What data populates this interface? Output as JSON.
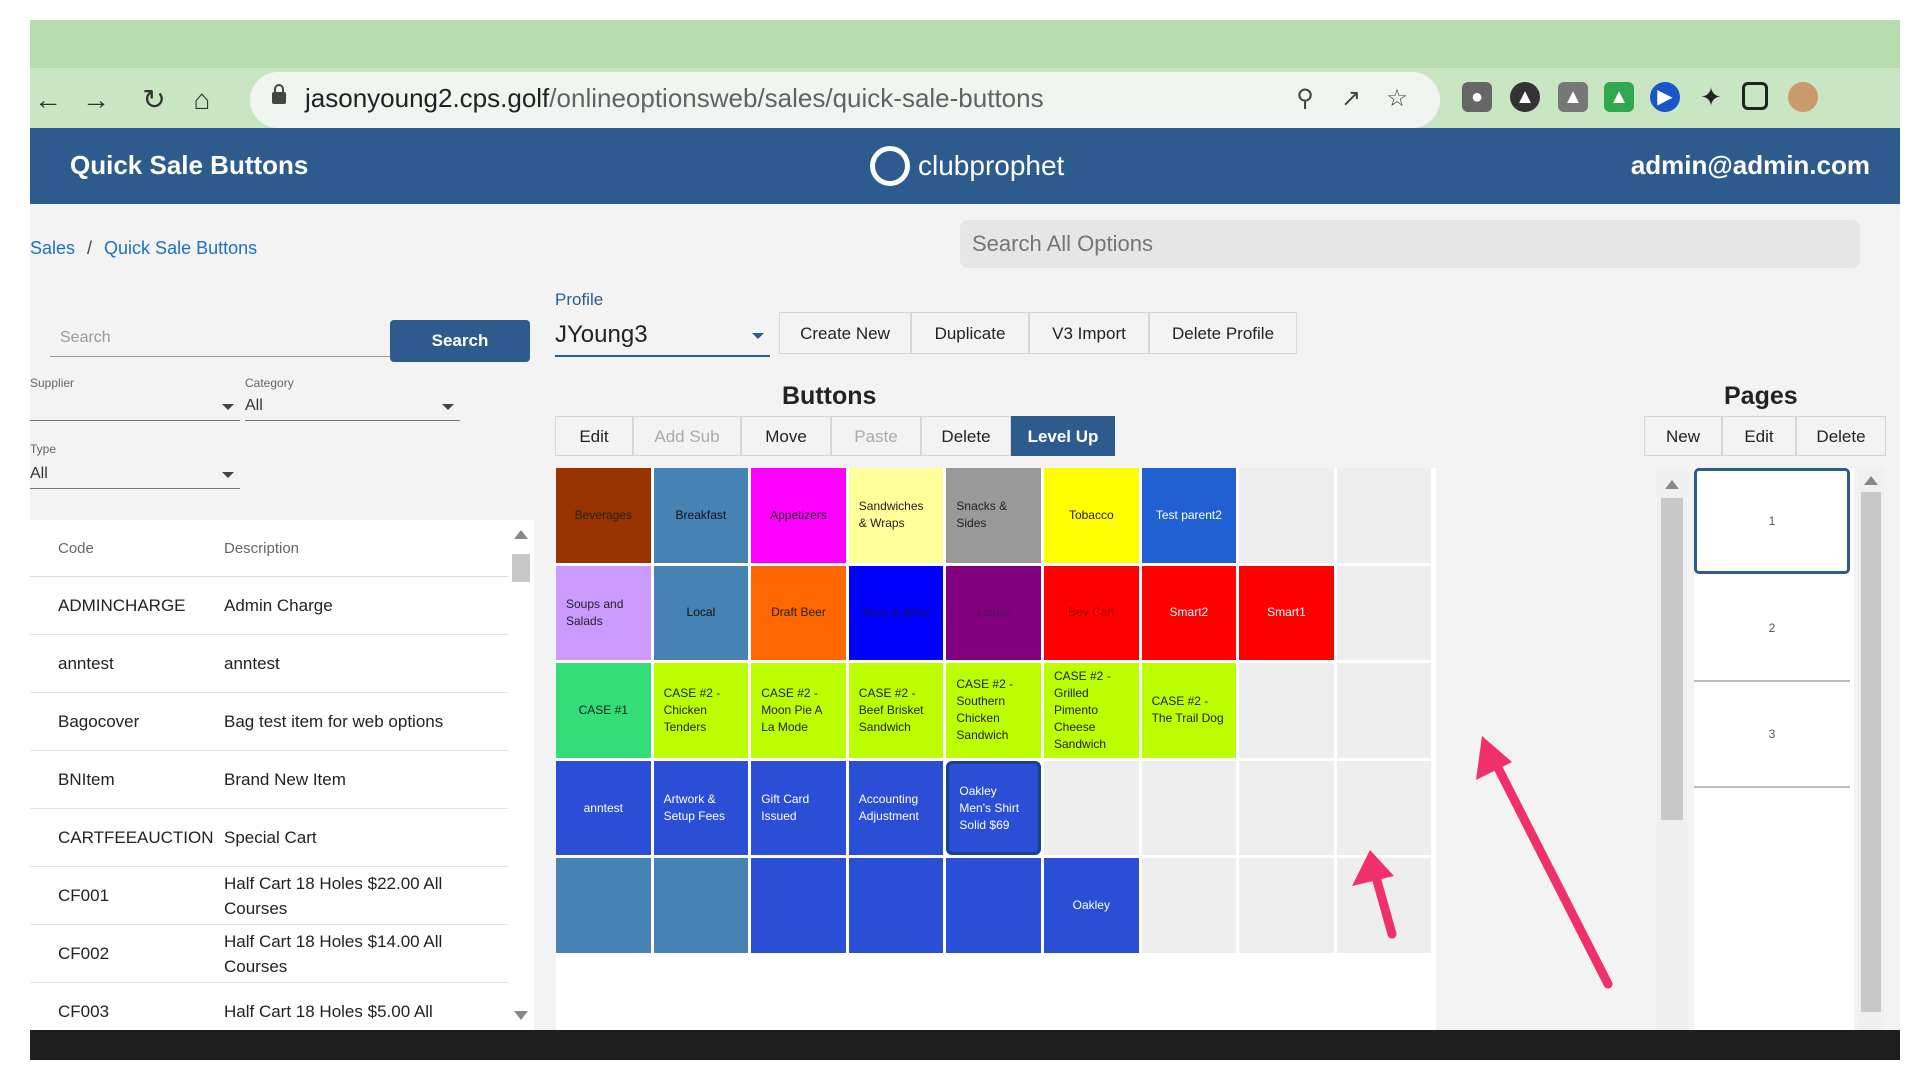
{
  "browser": {
    "url_host": "jasonyoung2.cps.golf",
    "url_path": "/onlineoptionsweb/sales/quick-sale-buttons"
  },
  "app": {
    "title": "Quick Sale Buttons",
    "logo": "clubprophet",
    "user": "admin@admin.com"
  },
  "breadcrumb": {
    "parent": "Sales",
    "current": "Quick Sale Buttons"
  },
  "global_search": {
    "placeholder": "Search All Options"
  },
  "left": {
    "search_placeholder": "Search",
    "search_button": "Search",
    "supplier_label": "Supplier",
    "category_label": "Category",
    "category_value": "All",
    "type_label": "Type",
    "type_value": "All",
    "columns": [
      "Code",
      "Description"
    ],
    "rows": [
      {
        "code": "ADMINCHARGE",
        "desc": "Admin Charge"
      },
      {
        "code": "anntest",
        "desc": "anntest"
      },
      {
        "code": "Bagocover",
        "desc": "Bag test item for web options"
      },
      {
        "code": "BNItem",
        "desc": "Brand New Item"
      },
      {
        "code": "CARTFEEAUCTION",
        "desc": "Special Cart"
      },
      {
        "code": "CF001",
        "desc": "Half Cart 18 Holes $22.00 All Courses"
      },
      {
        "code": "CF002",
        "desc": "Half Cart 18 Holes $14.00 All Courses"
      },
      {
        "code": "CF003",
        "desc": "Half Cart 18 Holes $5.00 All"
      }
    ]
  },
  "profile": {
    "label": "Profile",
    "value": "JYoung3",
    "actions": [
      "Create New",
      "Duplicate",
      "V3 Import",
      "Delete Profile"
    ]
  },
  "buttons_section": {
    "title": "Buttons",
    "actions": [
      "Edit",
      "Add Sub",
      "Move",
      "Paste",
      "Delete",
      "Level Up"
    ]
  },
  "pages_section": {
    "title": "Pages",
    "actions": [
      "New",
      "Edit",
      "Delete"
    ],
    "pages": [
      "1",
      "2",
      "3"
    ]
  },
  "grid": [
    [
      {
        "label": "Beverages",
        "bg": "#993300",
        "fg": "#222222"
      },
      {
        "label": "Breakfast",
        "bg": "#4682b4",
        "fg": "#111111"
      },
      {
        "label": "Appetizers",
        "bg": "#ff00ff",
        "fg": "#222222"
      },
      {
        "label": "Sandwiches & Wraps",
        "bg": "#ffff99",
        "fg": "#222222"
      },
      {
        "label": "Snacks & Sides",
        "bg": "#999999",
        "fg": "#222222"
      },
      {
        "label": "Tobacco",
        "bg": "#ffff00",
        "fg": "#222222"
      },
      {
        "label": "Test parent2",
        "bg": "#2060d0",
        "fg": "#ffffff"
      },
      {
        "label": "",
        "bg": "#eeeeee",
        "fg": "#222222"
      },
      {
        "label": "",
        "bg": "#eeeeee",
        "fg": "#222222"
      }
    ],
    [
      {
        "label": "Soups and Salads",
        "bg": "#cc99ff",
        "fg": "#222222"
      },
      {
        "label": "Local",
        "bg": "#4682b4",
        "fg": "#111111"
      },
      {
        "label": "Draft Beer",
        "bg": "#ff6600",
        "fg": "#222222"
      },
      {
        "label": "Beer & Wine",
        "bg": "#0000ff",
        "fg": "#111166"
      },
      {
        "label": "Liquor",
        "bg": "#800080",
        "fg": "#551155"
      },
      {
        "label": "Bev Cart",
        "bg": "#ff0000",
        "fg": "#aa0000"
      },
      {
        "label": "Smart2",
        "bg": "#ff0000",
        "fg": "#ffffff"
      },
      {
        "label": "Smart1",
        "bg": "#ff0000",
        "fg": "#ffffff"
      },
      {
        "label": "",
        "bg": "#eeeeee",
        "fg": "#222222"
      }
    ],
    [
      {
        "label": "CASE #1",
        "bg": "#33dd77",
        "fg": "#222222"
      },
      {
        "label": "CASE #2 - Chicken Tenders",
        "bg": "#bbff00",
        "fg": "#222222"
      },
      {
        "label": "CASE #2 - Moon Pie A La Mode",
        "bg": "#bbff00",
        "fg": "#222222"
      },
      {
        "label": "CASE #2 - Beef Brisket Sandwich",
        "bg": "#bbff00",
        "fg": "#222222"
      },
      {
        "label": "CASE #2 - Southern Chicken Sandwich",
        "bg": "#bbff00",
        "fg": "#222222"
      },
      {
        "label": "CASE #2 - Grilled Pimento Cheese Sandwich",
        "bg": "#bbff00",
        "fg": "#222222"
      },
      {
        "label": "CASE #2 - The Trail Dog",
        "bg": "#bbff00",
        "fg": "#222222"
      },
      {
        "label": "",
        "bg": "#eeeeee",
        "fg": "#222222"
      },
      {
        "label": "",
        "bg": "#eeeeee",
        "fg": "#222222"
      }
    ],
    [
      {
        "label": "anntest",
        "bg": "#2a4fd6",
        "fg": "#ffffff"
      },
      {
        "label": "Artwork & Setup Fees",
        "bg": "#2a4fd6",
        "fg": "#ffffff"
      },
      {
        "label": "Gift Card Issued",
        "bg": "#2a4fd6",
        "fg": "#ffffff"
      },
      {
        "label": "Accounting Adjustment",
        "bg": "#2a4fd6",
        "fg": "#ffffff"
      },
      {
        "label": "Oakley Men's Shirt Solid $69",
        "bg": "#2a4fd6",
        "fg": "#ffffff",
        "selected": true
      },
      {
        "label": "",
        "bg": "#eeeeee",
        "fg": "#222222"
      },
      {
        "label": "",
        "bg": "#eeeeee",
        "fg": "#222222"
      },
      {
        "label": "",
        "bg": "#eeeeee",
        "fg": "#222222"
      },
      {
        "label": "",
        "bg": "#eeeeee",
        "fg": "#222222"
      }
    ],
    [
      {
        "label": "",
        "bg": "#4682b4",
        "fg": "#ffffff"
      },
      {
        "label": "",
        "bg": "#4682b4",
        "fg": "#ffffff"
      },
      {
        "label": "",
        "bg": "#2a4fd6",
        "fg": "#ffffff"
      },
      {
        "label": "",
        "bg": "#2a4fd6",
        "fg": "#ffffff"
      },
      {
        "label": "",
        "bg": "#2a4fd6",
        "fg": "#ffffff"
      },
      {
        "label": "Oakley",
        "bg": "#2a4fd6",
        "fg": "#ffffff"
      },
      {
        "label": "",
        "bg": "#eeeeee",
        "fg": "#222222"
      },
      {
        "label": "",
        "bg": "#eeeeee",
        "fg": "#222222"
      },
      {
        "label": "",
        "bg": "#eeeeee",
        "fg": "#222222"
      }
    ]
  ],
  "colors": {
    "brand": "#2d5b8e",
    "annotation_arrow": "#f0306a"
  }
}
